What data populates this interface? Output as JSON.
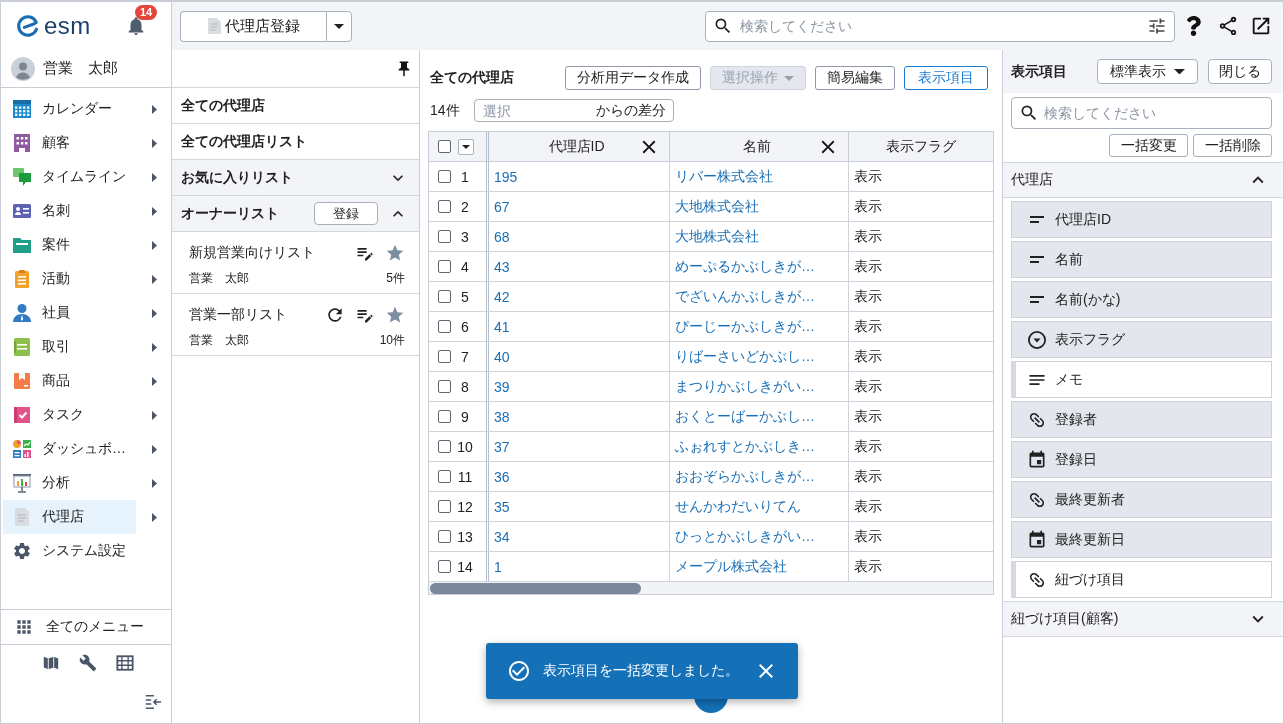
{
  "app": {
    "logo": "esm",
    "notification_count": "14",
    "user": "営業　太郎"
  },
  "sidebar": {
    "items": [
      {
        "label": "カレンダー",
        "selected": false,
        "submenu": true
      },
      {
        "label": "顧客",
        "selected": false,
        "submenu": true
      },
      {
        "label": "タイムライン",
        "selected": false,
        "submenu": true
      },
      {
        "label": "名刺",
        "selected": false,
        "submenu": true
      },
      {
        "label": "案件",
        "selected": false,
        "submenu": true
      },
      {
        "label": "活動",
        "selected": false,
        "submenu": true
      },
      {
        "label": "社員",
        "selected": false,
        "submenu": true
      },
      {
        "label": "取引",
        "selected": false,
        "submenu": true
      },
      {
        "label": "商品",
        "selected": false,
        "submenu": true
      },
      {
        "label": "タスク",
        "selected": false,
        "submenu": true
      },
      {
        "label": "ダッシュボ…",
        "selected": false,
        "submenu": true
      },
      {
        "label": "分析",
        "selected": false,
        "submenu": true
      },
      {
        "label": "代理店",
        "selected": true,
        "submenu": true
      },
      {
        "label": "システム設定",
        "selected": false,
        "submenu": false
      }
    ],
    "all_menu": "全てのメニュー"
  },
  "topbar": {
    "register_button": "代理店登録",
    "search": {
      "placeholder": "検索してください"
    }
  },
  "list_panel": {
    "views": [
      "全ての代理店",
      "全ての代理店リスト"
    ],
    "groups": [
      {
        "label": "お気に入りリスト",
        "expanded": false
      },
      {
        "label": "オーナーリスト",
        "expanded": true,
        "action": "登録",
        "lists": [
          {
            "name": "新規営業向けリスト",
            "owner": "営業　太郎",
            "count": "5件",
            "refresh": false,
            "starred": false
          },
          {
            "name": "営業一部リスト",
            "owner": "営業　太郎",
            "count": "10件",
            "refresh": true,
            "starred": false
          }
        ]
      }
    ]
  },
  "main": {
    "title": "全ての代理店",
    "toolbar": [
      {
        "label": "分析用データ作成",
        "disabled": false,
        "selected": false,
        "dropdown": false
      },
      {
        "label": "選択操作",
        "disabled": true,
        "selected": false,
        "dropdown": true
      },
      {
        "label": "簡易編集",
        "disabled": false,
        "selected": false,
        "dropdown": false
      },
      {
        "label": "表示項目",
        "disabled": false,
        "selected": true,
        "dropdown": false
      }
    ],
    "count": "14件",
    "diff_select": {
      "placeholder": "選択",
      "suffix": "からの差分"
    },
    "table": {
      "select_all_checked": false,
      "columns": [
        {
          "label": "代理店ID",
          "kind": "link",
          "removable": true
        },
        {
          "label": "名前",
          "kind": "link",
          "removable": true
        },
        {
          "label": "表示フラグ",
          "kind": "text",
          "removable": false
        }
      ],
      "rows": [
        {
          "number": "1",
          "checked": false,
          "cells": [
            "195",
            "リバー株式会社",
            "表示"
          ]
        },
        {
          "number": "2",
          "checked": false,
          "cells": [
            "67",
            "大地株式会社",
            "表示"
          ]
        },
        {
          "number": "3",
          "checked": false,
          "cells": [
            "68",
            "大地株式会社",
            "表示"
          ]
        },
        {
          "number": "4",
          "checked": false,
          "cells": [
            "43",
            "めーぷるかぶしきが…",
            "表示"
          ]
        },
        {
          "number": "5",
          "checked": false,
          "cells": [
            "42",
            "でざいんかぶしきが…",
            "表示"
          ]
        },
        {
          "number": "6",
          "checked": false,
          "cells": [
            "41",
            "ぴーじーかぶしきが…",
            "表示"
          ]
        },
        {
          "number": "7",
          "checked": false,
          "cells": [
            "40",
            "りばーさいどかぶし…",
            "表示"
          ]
        },
        {
          "number": "8",
          "checked": false,
          "cells": [
            "39",
            "まつりかぶしきがい…",
            "表示"
          ]
        },
        {
          "number": "9",
          "checked": false,
          "cells": [
            "38",
            "おくとーばーかぶし…",
            "表示"
          ]
        },
        {
          "number": "10",
          "checked": false,
          "cells": [
            "37",
            "ふぉれすとかぶしき…",
            "表示"
          ]
        },
        {
          "number": "11",
          "checked": false,
          "cells": [
            "36",
            "おおぞらかぶしきが…",
            "表示"
          ]
        },
        {
          "number": "12",
          "checked": false,
          "cells": [
            "35",
            "せんかわだいりてん",
            "表示"
          ]
        },
        {
          "number": "13",
          "checked": false,
          "cells": [
            "34",
            "ひっとかぶしきがい…",
            "表示"
          ]
        },
        {
          "number": "14",
          "checked": false,
          "cells": [
            "1",
            "メープル株式会社",
            "表示"
          ]
        }
      ]
    }
  },
  "toast": {
    "message": "表示項目を一括変更しました。"
  },
  "field_panel": {
    "title": "表示項目",
    "preset": "標準表示",
    "close": "閉じる",
    "search": {
      "placeholder": "検索してください"
    },
    "actions": [
      "一括変更",
      "一括削除"
    ],
    "sections": [
      {
        "label": "代理店",
        "expanded": true,
        "fields": [
          {
            "label": "代理店ID",
            "kind": "text",
            "selected": true
          },
          {
            "label": "名前",
            "kind": "text",
            "selected": true
          },
          {
            "label": "名前(かな)",
            "kind": "text",
            "selected": true
          },
          {
            "label": "表示フラグ",
            "kind": "select",
            "selected": true
          },
          {
            "label": "メモ",
            "kind": "textarea",
            "selected": false
          },
          {
            "label": "登録者",
            "kind": "reference",
            "selected": true
          },
          {
            "label": "登録日",
            "kind": "date",
            "selected": true
          },
          {
            "label": "最終更新者",
            "kind": "reference",
            "selected": true
          },
          {
            "label": "最終更新日",
            "kind": "date",
            "selected": true
          },
          {
            "label": "紐づけ項目",
            "kind": "reference",
            "selected": false
          }
        ]
      },
      {
        "label": "紐づけ項目(顧客)",
        "expanded": false
      }
    ]
  }
}
